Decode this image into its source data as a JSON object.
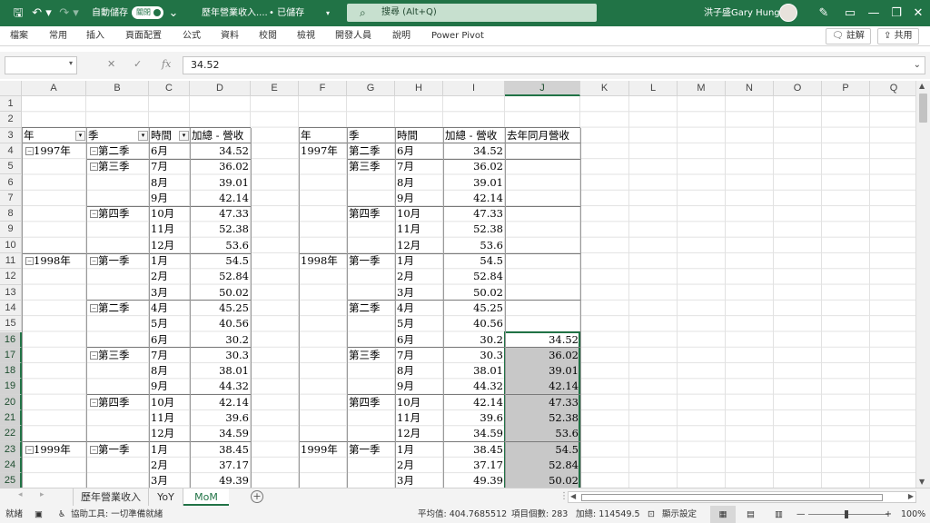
{
  "titlebar": {
    "autosave_label": "自動儲存",
    "autosave_state": "關閉",
    "filename": "歷年營業收入....",
    "saved_state": "• 已儲存",
    "search_placeholder": "搜尋 (Alt+Q)",
    "user_name": "洪子盛Gary Hung",
    "accent_color": "#217346"
  },
  "menu": {
    "items": [
      "檔案",
      "常用",
      "插入",
      "頁面配置",
      "公式",
      "資料",
      "校閱",
      "檢視",
      "開發人員",
      "說明",
      "Power Pivot"
    ],
    "comment_label": "註解",
    "share_label": "共用"
  },
  "formula_bar": {
    "name_box": "",
    "value": "34.52"
  },
  "columns": [
    "A",
    "B",
    "C",
    "D",
    "E",
    "F",
    "G",
    "H",
    "I",
    "J",
    "K",
    "L",
    "M",
    "N",
    "O",
    "P",
    "Q"
  ],
  "rows": [
    "1",
    "2",
    "3",
    "4",
    "5",
    "6",
    "7",
    "8",
    "9",
    "10",
    "11",
    "12",
    "13",
    "14",
    "15",
    "16",
    "17",
    "18",
    "19",
    "20",
    "21",
    "22",
    "23",
    "24",
    "25"
  ],
  "pivot1": {
    "headers": [
      "年",
      "季",
      "時間",
      "加總 - 營收"
    ],
    "years": [
      {
        "row": 4,
        "label": "1997年"
      },
      {
        "row": 11,
        "label": "1998年"
      },
      {
        "row": 23,
        "label": "1999年"
      }
    ],
    "quarters": [
      {
        "row": 4,
        "label": "第二季"
      },
      {
        "row": 5,
        "label": "第三季"
      },
      {
        "row": 8,
        "label": "第四季"
      },
      {
        "row": 11,
        "label": "第一季"
      },
      {
        "row": 14,
        "label": "第二季"
      },
      {
        "row": 17,
        "label": "第三季"
      },
      {
        "row": 20,
        "label": "第四季"
      },
      {
        "row": 23,
        "label": "第一季"
      }
    ],
    "months": [
      "6月",
      "7月",
      "8月",
      "9月",
      "10月",
      "11月",
      "12月",
      "1月",
      "2月",
      "3月",
      "4月",
      "5月",
      "6月",
      "7月",
      "8月",
      "9月",
      "10月",
      "11月",
      "12月",
      "1月",
      "2月",
      "3月"
    ],
    "values": [
      "34.52",
      "36.02",
      "39.01",
      "42.14",
      "47.33",
      "52.38",
      "53.6",
      "54.5",
      "52.84",
      "50.02",
      "45.25",
      "40.56",
      "30.2",
      "30.3",
      "38.01",
      "44.32",
      "42.14",
      "39.6",
      "34.59",
      "38.45",
      "37.17",
      "49.39"
    ]
  },
  "pivot2": {
    "headers": [
      "年",
      "季",
      "時間",
      "加總 - 營收",
      "去年同月營收"
    ],
    "years": [
      {
        "row": 4,
        "label": "1997年"
      },
      {
        "row": 11,
        "label": "1998年"
      },
      {
        "row": 23,
        "label": "1999年"
      }
    ],
    "quarters": [
      {
        "row": 4,
        "label": "第二季"
      },
      {
        "row": 5,
        "label": "第三季"
      },
      {
        "row": 8,
        "label": "第四季"
      },
      {
        "row": 11,
        "label": "第一季"
      },
      {
        "row": 14,
        "label": "第二季"
      },
      {
        "row": 17,
        "label": "第三季"
      },
      {
        "row": 20,
        "label": "第四季"
      },
      {
        "row": 23,
        "label": "第一季"
      }
    ],
    "prev_year": [
      "",
      "",
      "",
      "",
      "",
      "",
      "",
      "",
      "",
      "",
      "",
      "",
      "34.52",
      "36.02",
      "39.01",
      "42.14",
      "47.33",
      "52.38",
      "53.6",
      "54.5",
      "52.84",
      "50.02"
    ]
  },
  "sheets": {
    "tabs": [
      "歷年營業收入",
      "YoY",
      "MoM"
    ],
    "active": "MoM"
  },
  "status": {
    "ready": "就緒",
    "accessibility": "協助工具: 一切準備就緒",
    "average": "平均值: 404.7685512",
    "count": "項目個數: 283",
    "sum": "加總: 114549.5",
    "display_settings": "顯示設定",
    "zoom": "100%"
  }
}
